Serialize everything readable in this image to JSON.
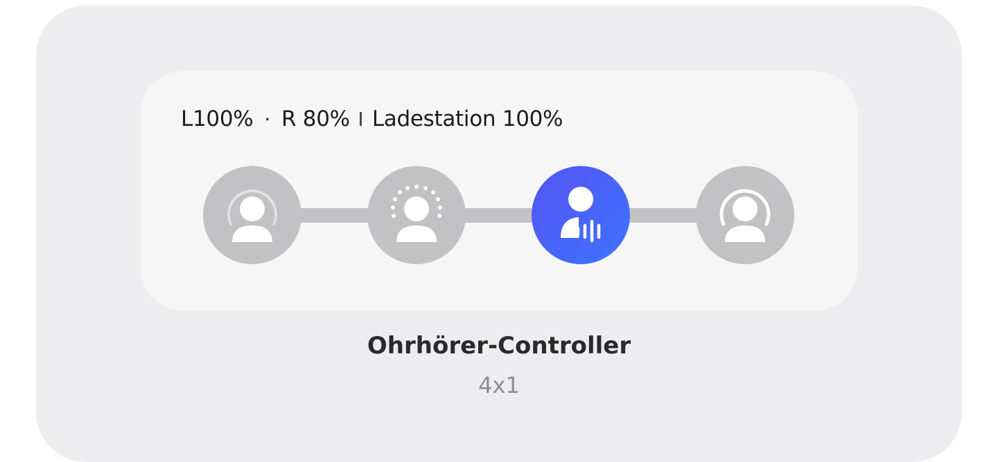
{
  "battery": {
    "left": "L100%",
    "dot": "·",
    "right": "R 80%",
    "case": "Ladestation 100%"
  },
  "modes": [
    {
      "name": "noise-cancelling",
      "icon": "person-arc-icon",
      "active": false
    },
    {
      "name": "ambient-sound",
      "icon": "person-dotted-arc-icon",
      "active": false
    },
    {
      "name": "voice-detect",
      "icon": "person-voice-icon",
      "active": true
    },
    {
      "name": "off",
      "icon": "person-ring-icon",
      "active": false
    }
  ],
  "widget": {
    "title": "Ohrhörer-Controller",
    "size": "4x1"
  },
  "colors": {
    "card_bg": "#ededef",
    "widget_bg": "#f6f6f7",
    "inactive": "#c2c2c4",
    "active_start": "#5553f2",
    "active_end": "#3d74ff"
  }
}
